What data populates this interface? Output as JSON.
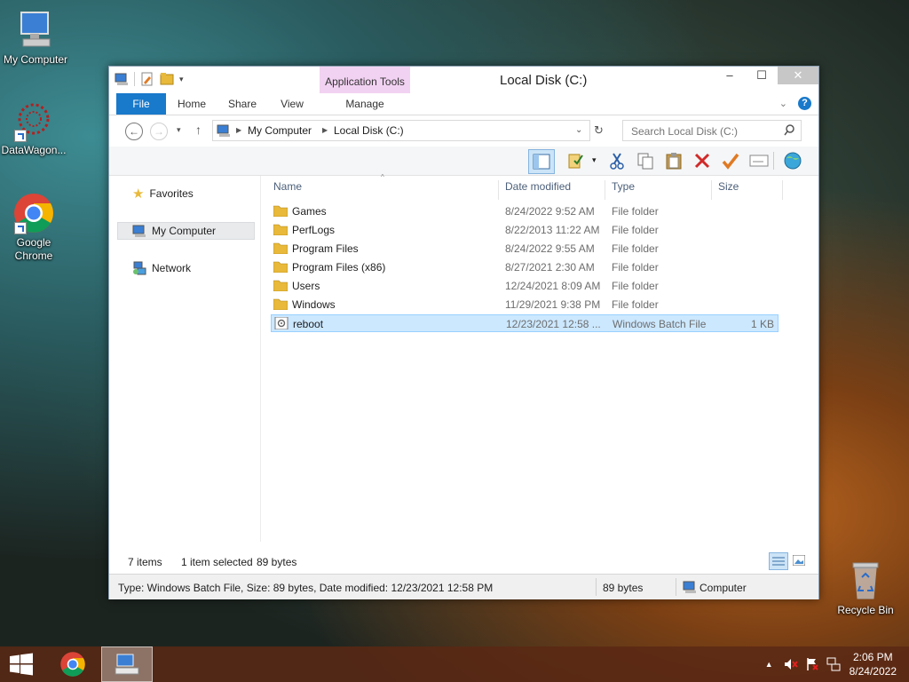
{
  "desktop": {
    "icons": [
      {
        "label": "My Computer"
      },
      {
        "label": "DataWagon..."
      },
      {
        "label": "Google\nChrome"
      },
      {
        "label": "Recycle Bin"
      }
    ]
  },
  "window": {
    "title": "Local Disk (C:)",
    "context_tab": "Application Tools",
    "ribbon_tabs": [
      "File",
      "Home",
      "Share",
      "View",
      "Manage"
    ],
    "winbuttons": {
      "minimize": "–",
      "maximize": "☐",
      "close": "✕"
    }
  },
  "address": {
    "crumbs": [
      "My Computer",
      "Local Disk (C:)"
    ],
    "search_placeholder": "Search Local Disk (C:)"
  },
  "sidebar": {
    "items": [
      "Favorites",
      "My Computer",
      "Network"
    ]
  },
  "columns": [
    "Name",
    "Date modified",
    "Type",
    "Size"
  ],
  "files": [
    {
      "name": "Games",
      "date": "8/24/2022 9:52 AM",
      "type": "File folder",
      "size": ""
    },
    {
      "name": "PerfLogs",
      "date": "8/22/2013 11:22 AM",
      "type": "File folder",
      "size": ""
    },
    {
      "name": "Program Files",
      "date": "8/24/2022 9:55 AM",
      "type": "File folder",
      "size": ""
    },
    {
      "name": "Program Files (x86)",
      "date": "8/27/2021 2:30 AM",
      "type": "File folder",
      "size": ""
    },
    {
      "name": "Users",
      "date": "12/24/2021 8:09 AM",
      "type": "File folder",
      "size": ""
    },
    {
      "name": "Windows",
      "date": "11/29/2021 9:38 PM",
      "type": "File folder",
      "size": ""
    },
    {
      "name": "reboot",
      "date": "12/23/2021 12:58 ...",
      "type": "Windows Batch File",
      "size": "1 KB"
    }
  ],
  "info": {
    "count": "7 items",
    "selection": "1 item selected",
    "selection_size": "89 bytes"
  },
  "status": {
    "details": "Type: Windows Batch File, Size: 89 bytes, Date modified: 12/23/2021 12:58 PM",
    "size": "89 bytes",
    "location": "Computer"
  },
  "taskbar": {
    "time": "2:06 PM",
    "date": "8/24/2022"
  },
  "colors": {
    "accent": "#1979ca",
    "context_tab": "#f2d2f2",
    "selection": "#cce8ff",
    "folder": "#e8b93a"
  }
}
